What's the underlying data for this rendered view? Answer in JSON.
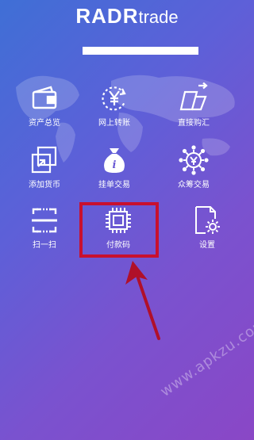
{
  "header": {
    "brand_bold": "RADR",
    "brand_light": "trade"
  },
  "grid": {
    "items": [
      {
        "label": "资产总览",
        "icon": "wallet-icon"
      },
      {
        "label": "网上转账",
        "icon": "yen-transfer-icon"
      },
      {
        "label": "直接购汇",
        "icon": "forex-buy-icon"
      },
      {
        "label": "添加货币",
        "icon": "add-currency-icon"
      },
      {
        "label": "挂单交易",
        "icon": "money-bag-icon"
      },
      {
        "label": "众筹交易",
        "icon": "crowdfunding-icon"
      },
      {
        "label": "扫一扫",
        "icon": "scan-icon"
      },
      {
        "label": "付款码",
        "icon": "payment-code-icon"
      },
      {
        "label": "设置",
        "icon": "settings-icon"
      }
    ]
  },
  "watermark": "www.apkzu.com",
  "colors": {
    "highlight": "#c8102e",
    "arrow": "#b0102a",
    "background_start": "#3f6fd6",
    "background_end": "#8a47c6"
  }
}
